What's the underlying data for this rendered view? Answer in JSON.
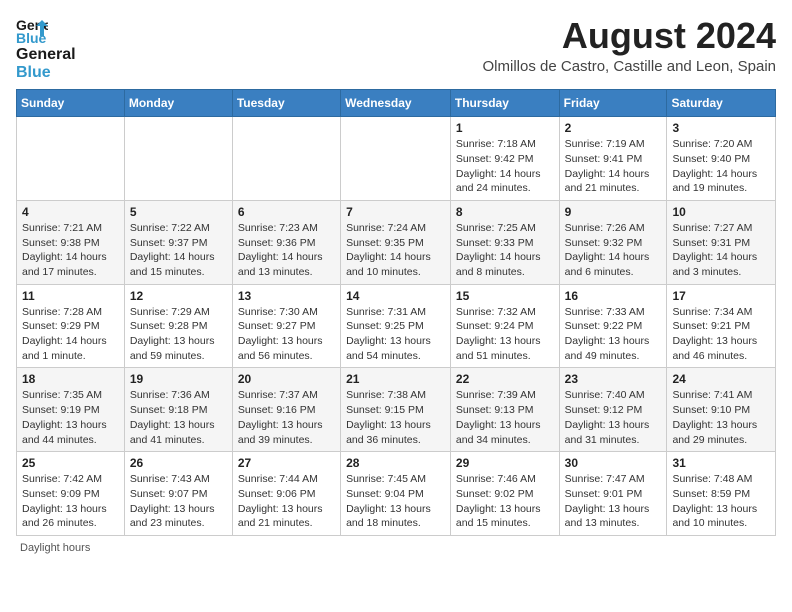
{
  "header": {
    "logo_general": "General",
    "logo_blue": "Blue",
    "month_title": "August 2024",
    "location": "Olmillos de Castro, Castille and Leon, Spain"
  },
  "columns": [
    "Sunday",
    "Monday",
    "Tuesday",
    "Wednesday",
    "Thursday",
    "Friday",
    "Saturday"
  ],
  "weeks": [
    [
      {
        "day": "",
        "info": ""
      },
      {
        "day": "",
        "info": ""
      },
      {
        "day": "",
        "info": ""
      },
      {
        "day": "",
        "info": ""
      },
      {
        "day": "1",
        "info": "Sunrise: 7:18 AM\nSunset: 9:42 PM\nDaylight: 14 hours and 24 minutes."
      },
      {
        "day": "2",
        "info": "Sunrise: 7:19 AM\nSunset: 9:41 PM\nDaylight: 14 hours and 21 minutes."
      },
      {
        "day": "3",
        "info": "Sunrise: 7:20 AM\nSunset: 9:40 PM\nDaylight: 14 hours and 19 minutes."
      }
    ],
    [
      {
        "day": "4",
        "info": "Sunrise: 7:21 AM\nSunset: 9:38 PM\nDaylight: 14 hours and 17 minutes."
      },
      {
        "day": "5",
        "info": "Sunrise: 7:22 AM\nSunset: 9:37 PM\nDaylight: 14 hours and 15 minutes."
      },
      {
        "day": "6",
        "info": "Sunrise: 7:23 AM\nSunset: 9:36 PM\nDaylight: 14 hours and 13 minutes."
      },
      {
        "day": "7",
        "info": "Sunrise: 7:24 AM\nSunset: 9:35 PM\nDaylight: 14 hours and 10 minutes."
      },
      {
        "day": "8",
        "info": "Sunrise: 7:25 AM\nSunset: 9:33 PM\nDaylight: 14 hours and 8 minutes."
      },
      {
        "day": "9",
        "info": "Sunrise: 7:26 AM\nSunset: 9:32 PM\nDaylight: 14 hours and 6 minutes."
      },
      {
        "day": "10",
        "info": "Sunrise: 7:27 AM\nSunset: 9:31 PM\nDaylight: 14 hours and 3 minutes."
      }
    ],
    [
      {
        "day": "11",
        "info": "Sunrise: 7:28 AM\nSunset: 9:29 PM\nDaylight: 14 hours and 1 minute."
      },
      {
        "day": "12",
        "info": "Sunrise: 7:29 AM\nSunset: 9:28 PM\nDaylight: 13 hours and 59 minutes."
      },
      {
        "day": "13",
        "info": "Sunrise: 7:30 AM\nSunset: 9:27 PM\nDaylight: 13 hours and 56 minutes."
      },
      {
        "day": "14",
        "info": "Sunrise: 7:31 AM\nSunset: 9:25 PM\nDaylight: 13 hours and 54 minutes."
      },
      {
        "day": "15",
        "info": "Sunrise: 7:32 AM\nSunset: 9:24 PM\nDaylight: 13 hours and 51 minutes."
      },
      {
        "day": "16",
        "info": "Sunrise: 7:33 AM\nSunset: 9:22 PM\nDaylight: 13 hours and 49 minutes."
      },
      {
        "day": "17",
        "info": "Sunrise: 7:34 AM\nSunset: 9:21 PM\nDaylight: 13 hours and 46 minutes."
      }
    ],
    [
      {
        "day": "18",
        "info": "Sunrise: 7:35 AM\nSunset: 9:19 PM\nDaylight: 13 hours and 44 minutes."
      },
      {
        "day": "19",
        "info": "Sunrise: 7:36 AM\nSunset: 9:18 PM\nDaylight: 13 hours and 41 minutes."
      },
      {
        "day": "20",
        "info": "Sunrise: 7:37 AM\nSunset: 9:16 PM\nDaylight: 13 hours and 39 minutes."
      },
      {
        "day": "21",
        "info": "Sunrise: 7:38 AM\nSunset: 9:15 PM\nDaylight: 13 hours and 36 minutes."
      },
      {
        "day": "22",
        "info": "Sunrise: 7:39 AM\nSunset: 9:13 PM\nDaylight: 13 hours and 34 minutes."
      },
      {
        "day": "23",
        "info": "Sunrise: 7:40 AM\nSunset: 9:12 PM\nDaylight: 13 hours and 31 minutes."
      },
      {
        "day": "24",
        "info": "Sunrise: 7:41 AM\nSunset: 9:10 PM\nDaylight: 13 hours and 29 minutes."
      }
    ],
    [
      {
        "day": "25",
        "info": "Sunrise: 7:42 AM\nSunset: 9:09 PM\nDaylight: 13 hours and 26 minutes."
      },
      {
        "day": "26",
        "info": "Sunrise: 7:43 AM\nSunset: 9:07 PM\nDaylight: 13 hours and 23 minutes."
      },
      {
        "day": "27",
        "info": "Sunrise: 7:44 AM\nSunset: 9:06 PM\nDaylight: 13 hours and 21 minutes."
      },
      {
        "day": "28",
        "info": "Sunrise: 7:45 AM\nSunset: 9:04 PM\nDaylight: 13 hours and 18 minutes."
      },
      {
        "day": "29",
        "info": "Sunrise: 7:46 AM\nSunset: 9:02 PM\nDaylight: 13 hours and 15 minutes."
      },
      {
        "day": "30",
        "info": "Sunrise: 7:47 AM\nSunset: 9:01 PM\nDaylight: 13 hours and 13 minutes."
      },
      {
        "day": "31",
        "info": "Sunrise: 7:48 AM\nSunset: 8:59 PM\nDaylight: 13 hours and 10 minutes."
      }
    ]
  ],
  "footer": {
    "note": "Daylight hours"
  }
}
